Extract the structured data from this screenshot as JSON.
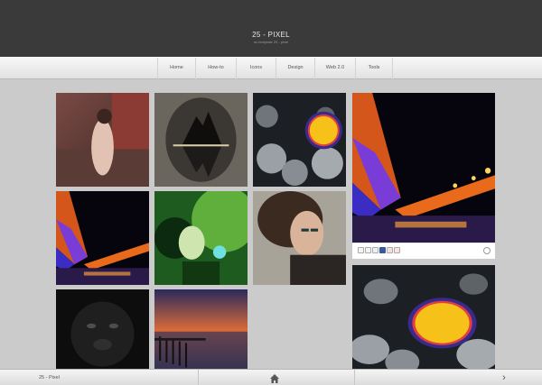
{
  "header": {
    "title": "25 - PIXEL",
    "tagline": "no template 25 - pixel"
  },
  "nav": {
    "items": [
      {
        "label": "Home"
      },
      {
        "label": "How-to"
      },
      {
        "label": "Icons"
      },
      {
        "label": "Design"
      },
      {
        "label": "Web 2.0"
      },
      {
        "label": "Tools"
      }
    ]
  },
  "gallery": {
    "tiles": [
      {
        "subject": "woman-on-train"
      },
      {
        "subject": "dark-mountain-reflection"
      },
      {
        "subject": "hot-air-balloon-over-clouds"
      },
      {
        "subject": "neon-bridge-night"
      },
      {
        "subject": "neon-bridge-night"
      },
      {
        "subject": "green-fantasy-woman"
      },
      {
        "subject": "woman-portrait"
      },
      {
        "subject": "black-dog"
      },
      {
        "subject": "pier-at-sunset"
      },
      {
        "subject": "hot-air-balloon-over-clouds"
      }
    ]
  },
  "share_bar": {
    "icons": [
      "email-icon",
      "blog-icon",
      "twitter-icon",
      "facebook-icon",
      "pinterest-icon",
      "google-plus-icon"
    ],
    "comment_icon": "comment-count-icon"
  },
  "footer": {
    "label": "25 - Pixel",
    "home_icon": "home-icon",
    "next_icon": "chevron-right-icon"
  }
}
